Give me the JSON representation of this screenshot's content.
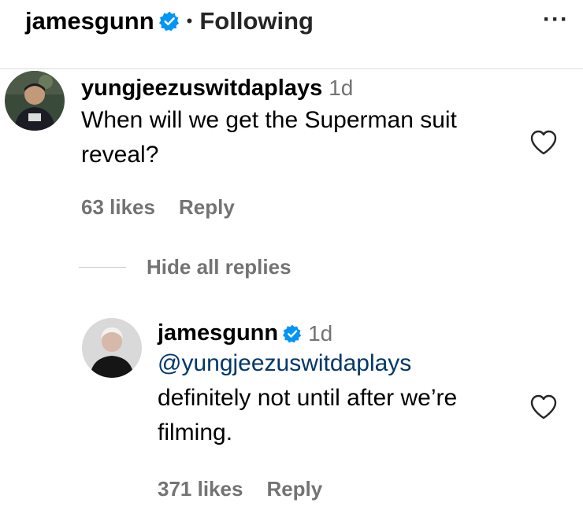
{
  "header": {
    "username": "jamesgunn",
    "separator": "•",
    "follow_status": "Following",
    "more_label": "···"
  },
  "comments": [
    {
      "username": "yungjeezuswitdaplays",
      "time": "1d",
      "text_line1": "When will we get the Superman suit",
      "text_line2": "reveal?",
      "likes": "63 likes",
      "reply_label": "Reply"
    }
  ],
  "hide_replies_label": "Hide all replies",
  "replies": [
    {
      "username": "jamesgunn",
      "time": "1d",
      "mention": "@yungjeezuswitdaplays",
      "text_line1": "definitely not until after we’re",
      "text_line2": "filming.",
      "likes": "371 likes",
      "reply_label": "Reply"
    }
  ],
  "colors": {
    "verified": "#0095f6",
    "mention": "#00376b",
    "secondary_text": "#737373"
  },
  "icons": [
    "verified-badge-icon",
    "more-options-icon",
    "heart-icon"
  ]
}
